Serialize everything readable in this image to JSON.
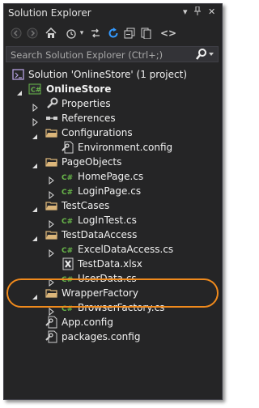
{
  "window": {
    "title": "Solution Explorer"
  },
  "search": {
    "placeholder": "Search Solution Explorer (Ctrl+;)"
  },
  "tree": {
    "solution": "Solution 'OnlineStore' (1 project)",
    "project": "OnlineStore",
    "properties": "Properties",
    "references": "References",
    "configurations": "Configurations",
    "environment_config": "Environment.config",
    "page_objects": "PageObjects",
    "home_page": "HomePage.cs",
    "login_page": "LoginPage.cs",
    "test_cases": "TestCases",
    "login_test": "LogInTest.cs",
    "test_data_access": "TestDataAccess",
    "excel_data_access": "ExcelDataAccess.cs",
    "test_data": "TestData.xlsx",
    "user_data": "UserData.cs",
    "wrapper_factory": "WrapperFactory",
    "browser_factory": "BrowserFactory.cs",
    "app_config": "App.config",
    "packages_config": "packages.config"
  },
  "colors": {
    "background": "#252526",
    "text": "#f1f1f1",
    "folder": "#dcb67a",
    "csharp": "#68b64a",
    "highlight": "#f08a1c",
    "accent": "#3399ff"
  }
}
